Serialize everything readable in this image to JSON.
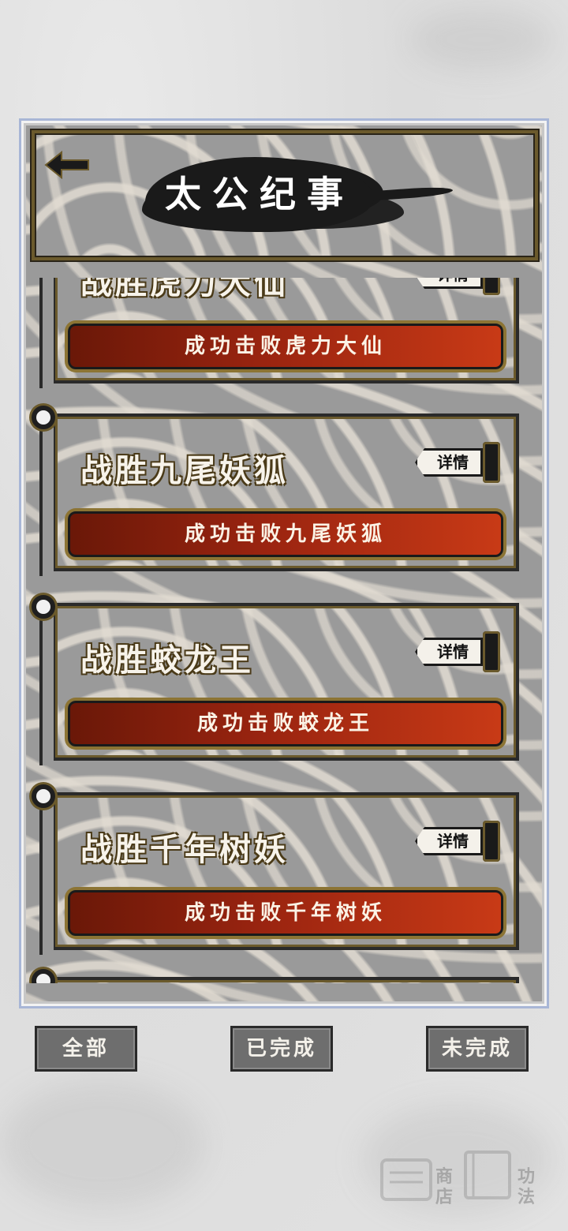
{
  "header": {
    "title": "太公纪事",
    "back_icon": "arrow-left-icon"
  },
  "cards": [
    {
      "title": "战胜虎力大仙",
      "bar_text": "成功击败虎力大仙",
      "detail_label": "详情",
      "partial": true
    },
    {
      "title": "战胜九尾妖狐",
      "bar_text": "成功击败九尾妖狐",
      "detail_label": "详情"
    },
    {
      "title": "战胜蛟龙王",
      "bar_text": "成功击败蛟龙王",
      "detail_label": "详情"
    },
    {
      "title": "战胜千年树妖",
      "bar_text": "成功击败千年树妖",
      "detail_label": "详情"
    }
  ],
  "filters": {
    "all": "全部",
    "completed": "已完成",
    "incomplete": "未完成"
  },
  "background_icons": {
    "shop_label": "商店",
    "skills_label": "功法"
  },
  "colors": {
    "accent_red": "#c83a16",
    "gold_trim": "#6b5a2c",
    "panel_border": "#a8b6d6"
  }
}
